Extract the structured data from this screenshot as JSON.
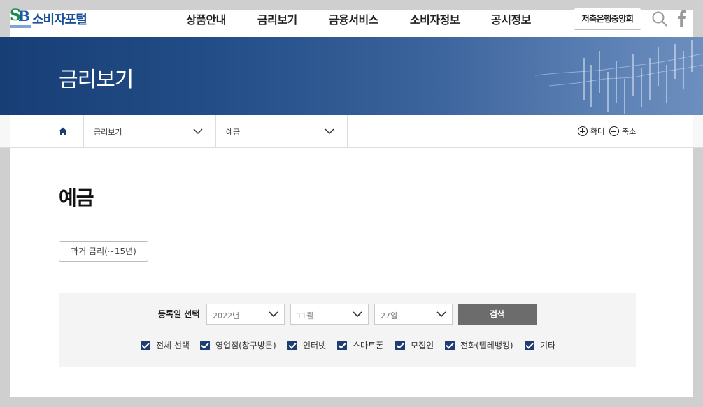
{
  "header": {
    "logo_text": "소비자포털",
    "nav": [
      "상품안내",
      "금리보기",
      "금융서비스",
      "소비자정보",
      "공시정보"
    ],
    "assoc_button": "저축은행중앙회",
    "icons": [
      "search-icon",
      "facebook-icon"
    ]
  },
  "banner": {
    "title": "금리보기"
  },
  "breadcrumb": {
    "home_icon": "home-icon",
    "level1": "금리보기",
    "level2": "예금",
    "zoom_in": "확대",
    "zoom_out": "축소"
  },
  "main": {
    "title": "예금",
    "past_rates_button": "과거 금리(~15년)"
  },
  "filter": {
    "reg_date_label": "등록일 선택",
    "year": "2022년",
    "month": "11월",
    "day": "27일",
    "search_button": "검색",
    "checkboxes": [
      {
        "label": "전체 선택",
        "checked": true
      },
      {
        "label": "영업점(창구방문)",
        "checked": true
      },
      {
        "label": "인터넷",
        "checked": true
      },
      {
        "label": "스마트폰",
        "checked": true
      },
      {
        "label": "모집인",
        "checked": true
      },
      {
        "label": "전화(텔레뱅킹)",
        "checked": true
      },
      {
        "label": "기타",
        "checked": true
      }
    ]
  },
  "colors": {
    "checkbox": "#1e3d73",
    "banner": "#224d86",
    "search_button": "#6c6c6c"
  }
}
